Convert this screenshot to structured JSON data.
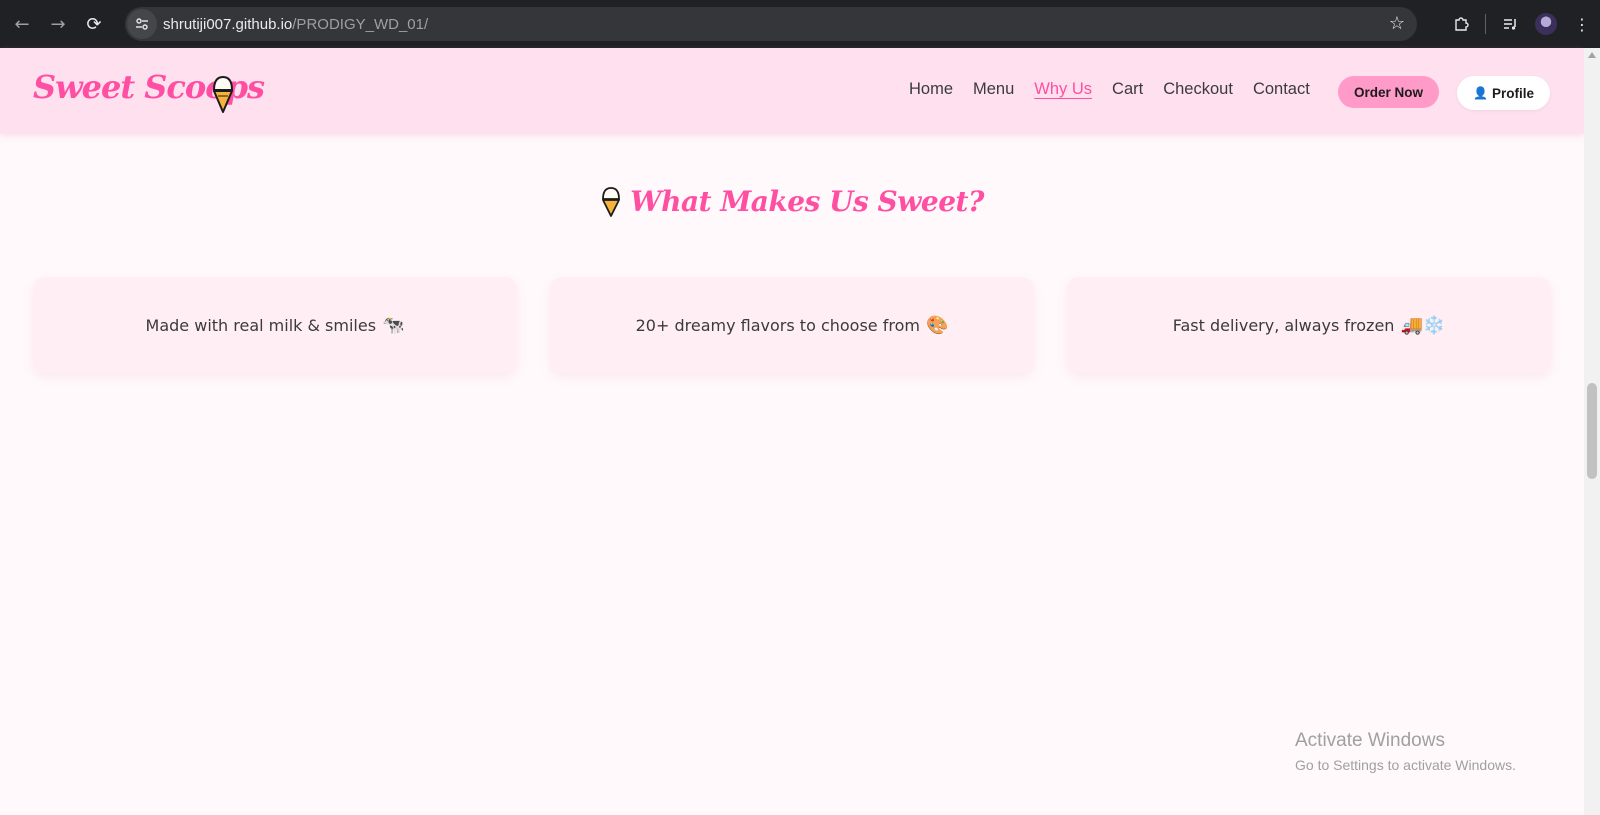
{
  "browser": {
    "url_host": "shrutiji007.github.io",
    "url_path": "/PRODIGY_WD_01/",
    "icons": [
      "back-icon",
      "forward-icon",
      "reload-icon",
      "site-settings-icon",
      "star-icon",
      "extensions-icon",
      "media-icon",
      "profile-avatar",
      "menu-icon"
    ]
  },
  "site": {
    "logo_text": "Sweet Scoops",
    "nav": [
      {
        "label": "Home"
      },
      {
        "label": "Menu"
      },
      {
        "label": "Why Us",
        "active": true
      },
      {
        "label": "Cart"
      },
      {
        "label": "Checkout"
      },
      {
        "label": "Contact"
      }
    ],
    "order_button": "Order Now",
    "profile_button": "Profile",
    "profile_icon": "👤"
  },
  "why_us": {
    "title": "What Makes Us Sweet?",
    "cards": [
      {
        "text": "Made with real milk & smiles",
        "emoji": "🐄"
      },
      {
        "text": "20+ dreamy flavors to choose from",
        "emoji": "🎨"
      },
      {
        "text": "Fast delivery, always frozen",
        "emoji": "🚚❄️"
      }
    ]
  },
  "watermark": {
    "line1": "Activate Windows",
    "line2": "Go to Settings to activate Windows."
  },
  "colors": {
    "accent": "#ff4fa3",
    "header_bg": "#ffe0ee",
    "page_bg": "#fff9fb",
    "card_bg": "#ffeff5",
    "order_button_bg": "#ff9ac9"
  }
}
